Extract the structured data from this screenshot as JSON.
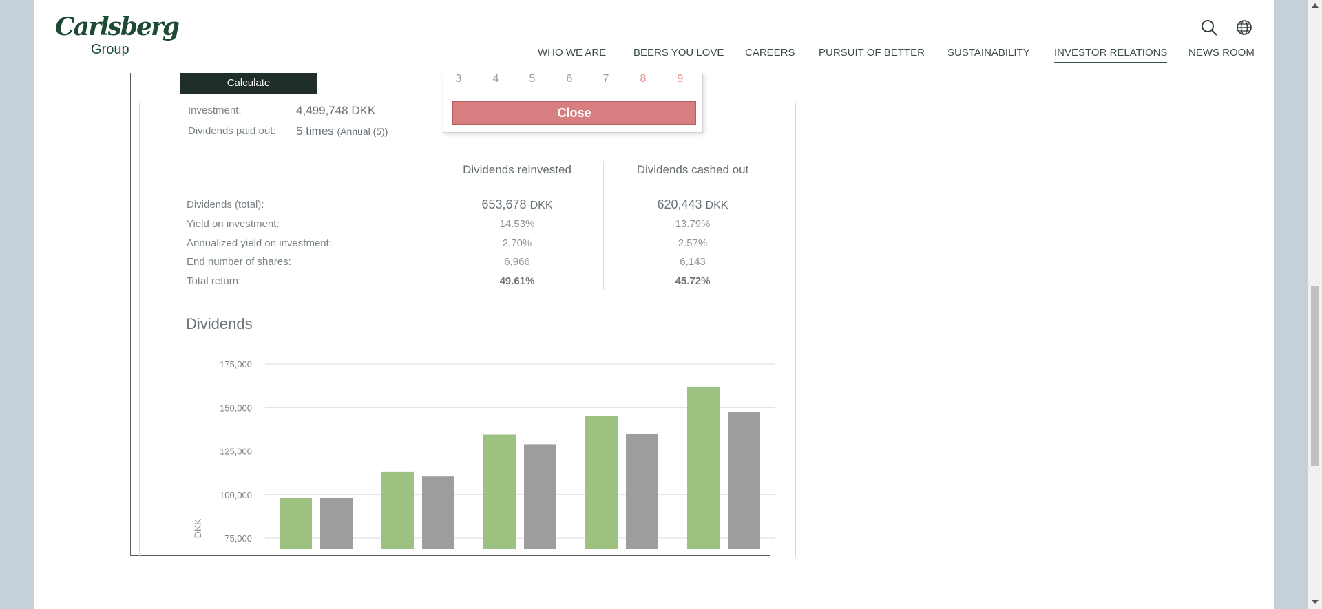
{
  "header": {
    "logo": {
      "script": "Carlsberg",
      "group": "Group"
    },
    "nav": [
      {
        "label": "WHO WE ARE"
      },
      {
        "label": "BEERS YOU LOVE"
      },
      {
        "label": "CAREERS"
      },
      {
        "label": "PURSUIT OF BETTER"
      },
      {
        "label": "SUSTAINABILITY"
      },
      {
        "label": "INVESTOR RELATIONS",
        "active": true
      },
      {
        "label": "NEWS ROOM"
      }
    ],
    "icons": [
      "search-icon",
      "globe-icon"
    ]
  },
  "calculator": {
    "calculate_label": "Calculate",
    "investment_label": "Investment:",
    "investment_value": "4,499,748 DKK",
    "dividends_paid_label": "Dividends paid out:",
    "dividends_paid_value": "5 times",
    "dividends_paid_note": "(Annual (5))"
  },
  "datepicker": {
    "days": [
      "3",
      "4",
      "5",
      "6",
      "7",
      "8",
      "9"
    ],
    "weekend_days": [
      "8",
      "9"
    ],
    "close_label": "Close"
  },
  "results": {
    "col_reinvested": "Dividends reinvested",
    "col_cashed": "Dividends cashed out",
    "rows": [
      {
        "label": "Dividends (total):",
        "reinvested": "653,678",
        "cashed": "620,443",
        "unit": "DKK"
      },
      {
        "label": "Yield on investment:",
        "reinvested": "14.53%",
        "cashed": "13.79%"
      },
      {
        "label": "Annualized yield on investment:",
        "reinvested": "2.70%",
        "cashed": "2.57%"
      },
      {
        "label": "End number of shares:",
        "reinvested": "6,966",
        "cashed": "6,143"
      },
      {
        "label": "Total return:",
        "reinvested": "49.61%",
        "cashed": "45.72%"
      }
    ]
  },
  "dividends_section": {
    "title": "Dividends"
  },
  "chart_data": {
    "type": "bar",
    "ylabel": "DKK",
    "yticks": [
      "175,000",
      "150,000",
      "125,000",
      "100,000",
      "75,000"
    ],
    "ytick_values": [
      175000,
      150000,
      125000,
      100000,
      75000
    ],
    "ylim": [
      75000,
      175000
    ],
    "grid": true,
    "series": [
      {
        "values": [
          98000,
          113000,
          134500,
          145000,
          162000
        ],
        "color": "#9cc180"
      },
      {
        "values": [
          98000,
          110500,
          129000,
          135000,
          147500
        ],
        "color": "#9d9d9d"
      }
    ]
  }
}
